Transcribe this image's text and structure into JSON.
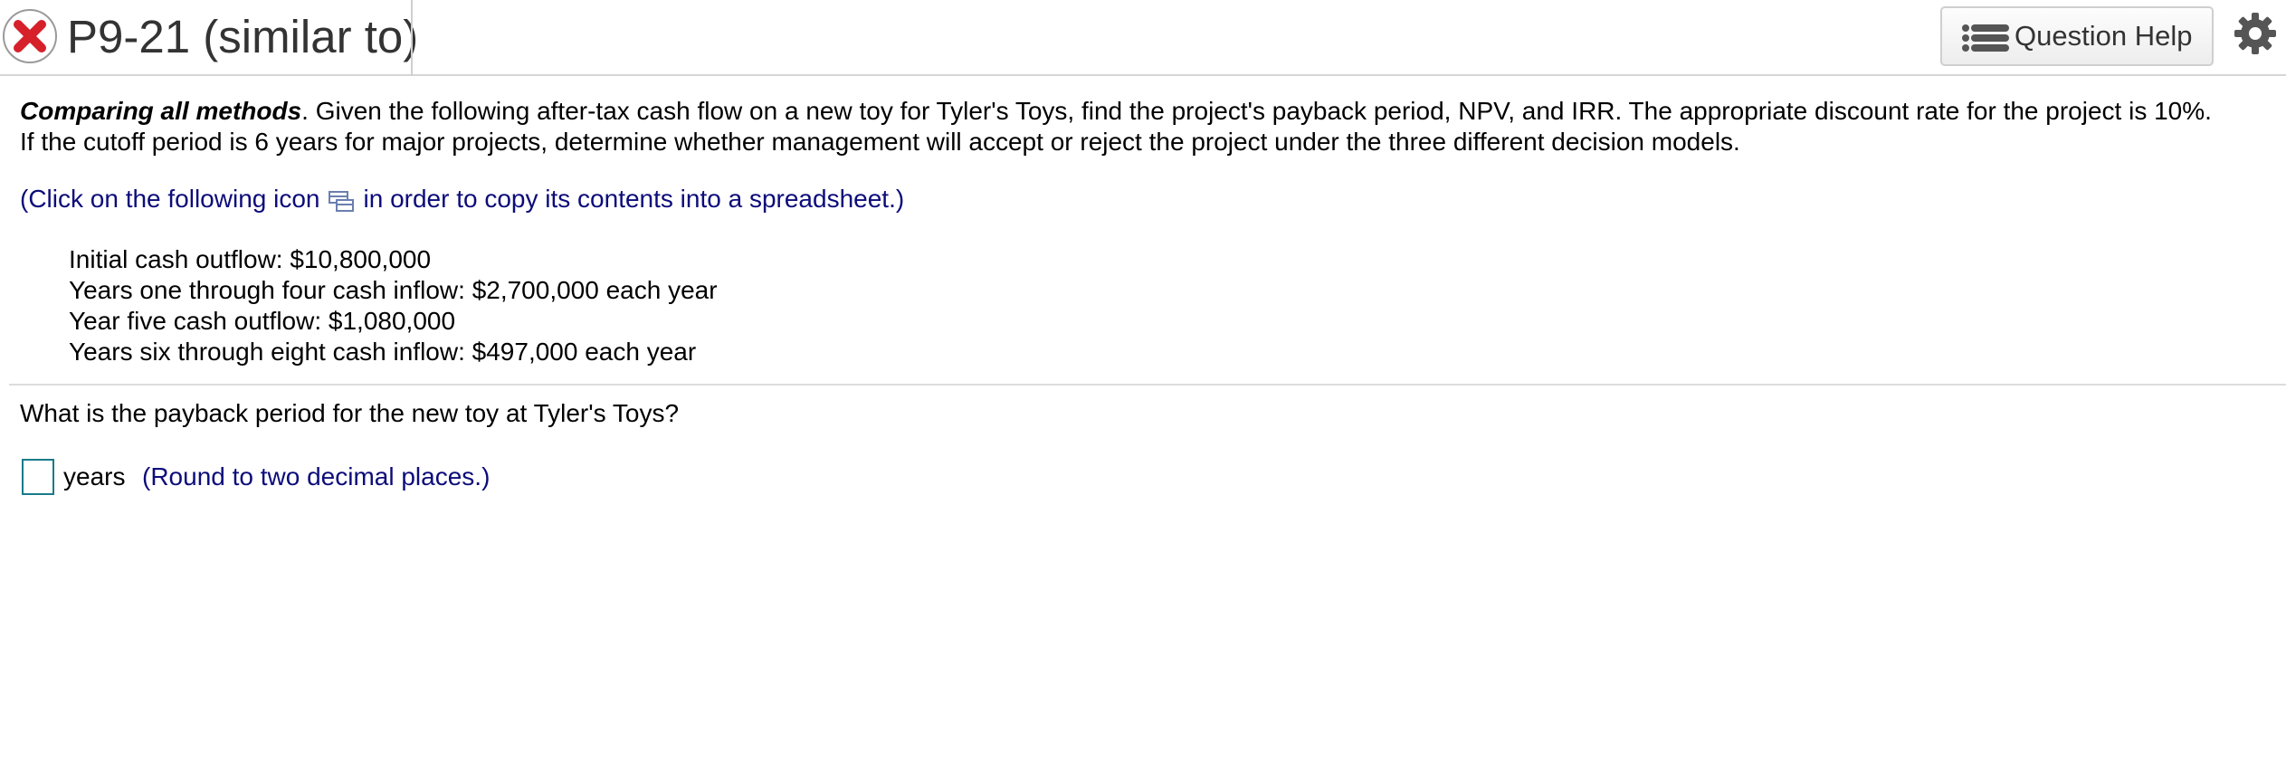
{
  "header": {
    "status_icon": "x-circle-icon",
    "title": "P9-21 (similar to)",
    "help_button_label": "Question Help",
    "help_button_icon": "list-icon",
    "settings_icon": "gear-icon"
  },
  "problem": {
    "lead": "Comparing all methods",
    "line1_rest": ". Given the following after-tax cash flow on a new toy for Tyler's Toys, find the project's payback period, NPV, and IRR. The appropriate discount rate for the project is 10%.",
    "line2": "If the cutoff period is 6 years for major projects, determine whether management will accept or reject the project under the three different decision models.",
    "copy_prefix": "(Click on the following icon",
    "copy_suffix": "in order to copy its contents into a spreadsheet.)",
    "copy_icon": "spreadsheet-copy-icon",
    "cash_flows": [
      "Initial cash outflow: $10,800,000",
      "Years one through four cash inflow: $2,700,000 each year",
      "Year five cash outflow: $1,080,000",
      "Years six through eight cash inflow: $497,000 each year"
    ]
  },
  "question": {
    "prompt": "What is the payback period for the new toy at Tyler's Toys?",
    "answer_value": "",
    "unit": "years",
    "hint": "(Round to two decimal places.)"
  },
  "colors": {
    "error_red": "#d6202a",
    "hint_navy": "#0c0c7a",
    "input_border": "#1a7a8a",
    "icon_gray": "#555555"
  }
}
